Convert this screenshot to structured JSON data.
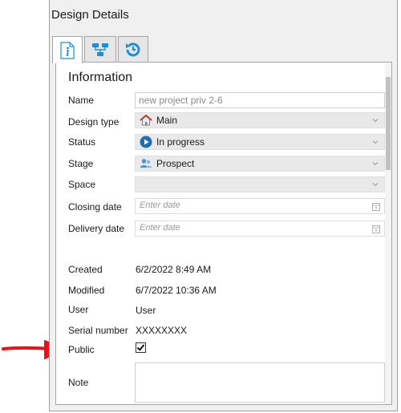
{
  "panel": {
    "title": "Design Details"
  },
  "tabs": [
    {
      "icon": "info-icon",
      "active": true
    },
    {
      "icon": "hierarchy-icon",
      "active": false
    },
    {
      "icon": "history-icon",
      "active": false
    }
  ],
  "info": {
    "title": "Information",
    "name": {
      "label": "Name",
      "value": "new project priv 2-6"
    },
    "design_type": {
      "label": "Design type",
      "value": "Main",
      "icon": "house-icon"
    },
    "status": {
      "label": "Status",
      "value": "In progress",
      "icon": "play-circle-icon"
    },
    "stage": {
      "label": "Stage",
      "value": "Prospect",
      "icon": "people-icon"
    },
    "space": {
      "label": "Space",
      "value": ""
    },
    "closing_date": {
      "label": "Closing date",
      "placeholder": "Enter date"
    },
    "delivery_date": {
      "label": "Delivery date",
      "placeholder": "Enter date"
    },
    "created": {
      "label": "Created",
      "value": "6/2/2022 8:49 AM"
    },
    "modified": {
      "label": "Modified",
      "value": "6/7/2022 10:36 AM"
    },
    "user": {
      "label": "User",
      "value": "User"
    },
    "serial": {
      "label": "Serial number",
      "value": "XXXXXXXX"
    },
    "public": {
      "label": "Public",
      "checked": true
    },
    "note": {
      "label": "Note",
      "value": ""
    }
  },
  "colors": {
    "accent": "#1e8fd6",
    "arrow": "#e3141b",
    "house": "#c0392b"
  }
}
